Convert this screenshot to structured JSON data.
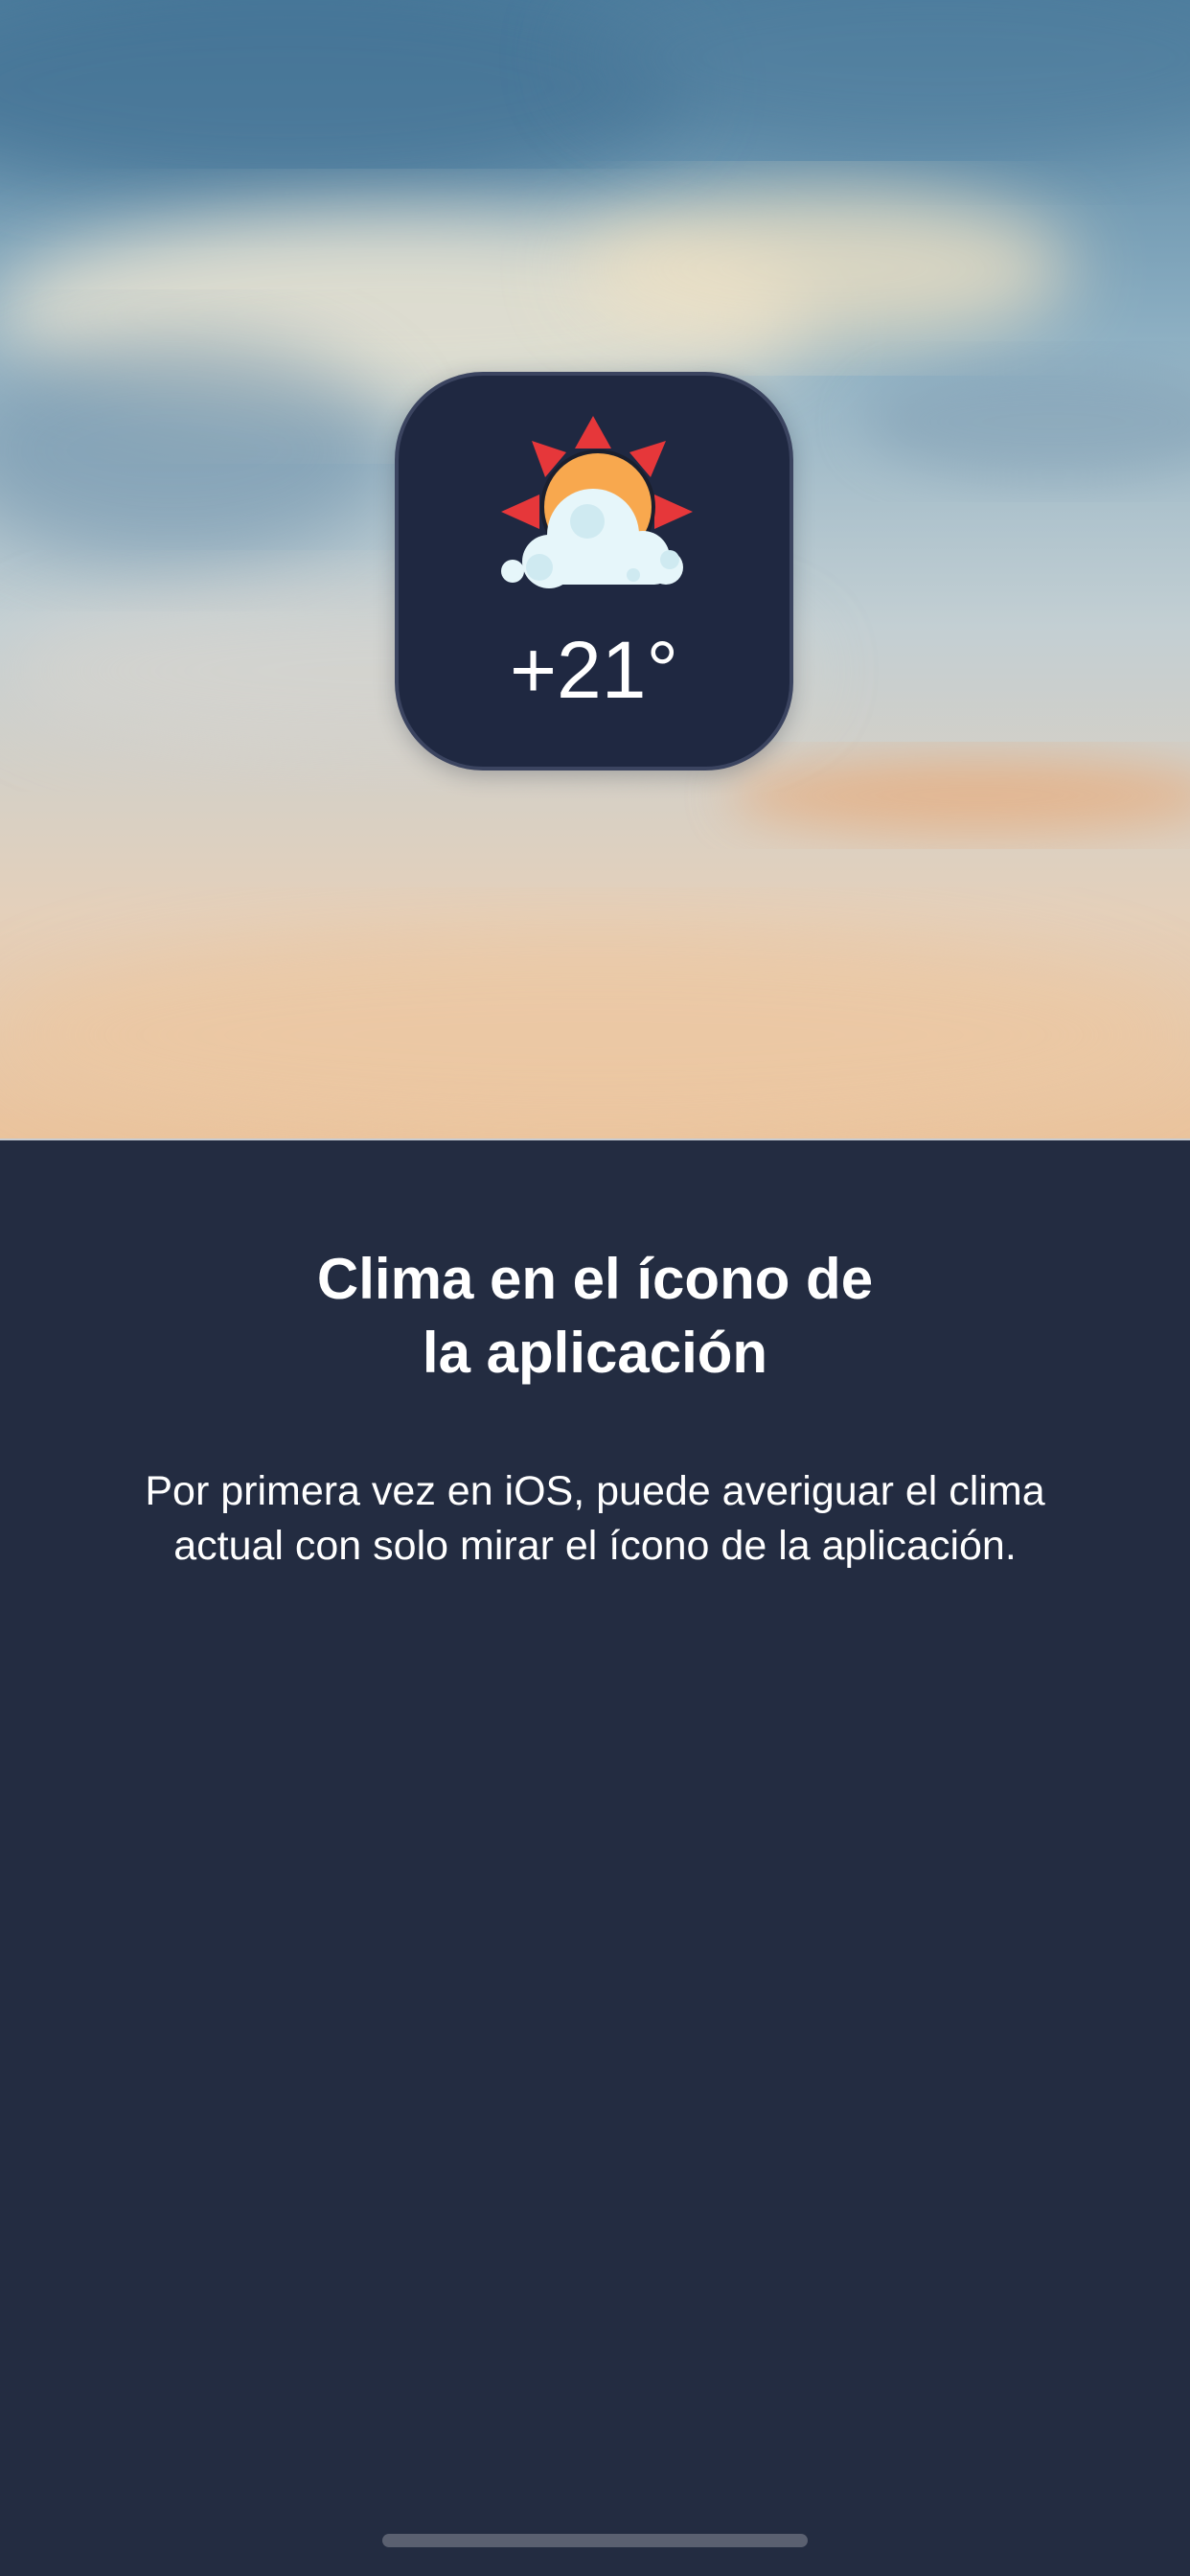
{
  "hero": {
    "icon": "partly-cloudy-sun-icon",
    "temperature": "+21°",
    "colors": {
      "icon_background": "#1f2841",
      "sun": "#f8a84e",
      "sun_rays": "#e6373a",
      "cloud": "#e6f6fa"
    }
  },
  "onboarding": {
    "title_line1": "Clima en el ícono de",
    "title_line2": "la aplicación",
    "description_line1": "Por primera vez en iOS, puede averiguar el clima",
    "description_line2": "actual con solo mirar el ícono de la aplicación."
  },
  "colors": {
    "background": "#232c41",
    "text": "#ffffff"
  }
}
